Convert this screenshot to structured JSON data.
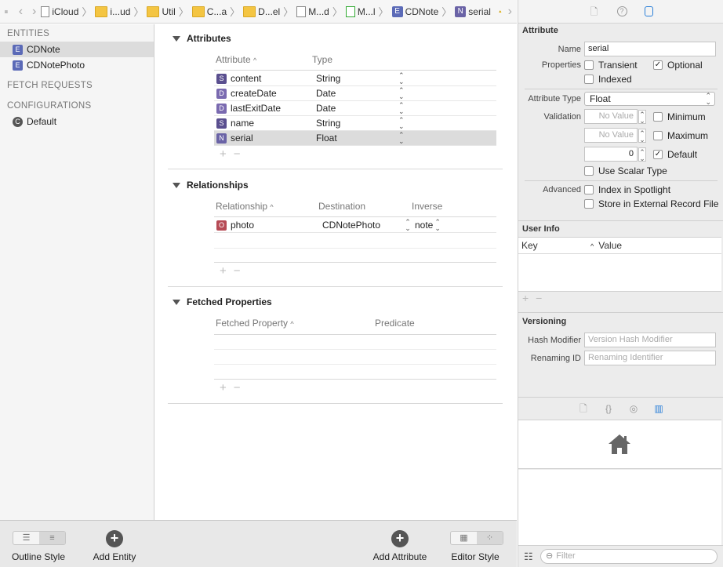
{
  "breadcrumb": {
    "items": [
      {
        "label": "iCloud",
        "icon": "folder-icon"
      },
      {
        "label": "i...ud",
        "icon": "folder-icon"
      },
      {
        "label": "Util",
        "icon": "folder-icon"
      },
      {
        "label": "C...a",
        "icon": "folder-icon"
      },
      {
        "label": "D...el",
        "icon": "folder-icon"
      },
      {
        "label": "M...d",
        "icon": "model-file-icon"
      },
      {
        "label": "M...l",
        "icon": "model-version-icon"
      },
      {
        "label": "CDNote",
        "icon": "entity-icon",
        "badge": "E"
      },
      {
        "label": "serial",
        "icon": "attribute-icon",
        "badge": "N"
      }
    ]
  },
  "sidebar": {
    "entities_header": "ENTITIES",
    "entities": [
      {
        "label": "CDNote",
        "badge": "E",
        "selected": true
      },
      {
        "label": "CDNotePhoto",
        "badge": "E",
        "selected": false
      }
    ],
    "fetch_header": "FETCH REQUESTS",
    "config_header": "CONFIGURATIONS",
    "configurations": [
      {
        "label": "Default",
        "badge": "C"
      }
    ]
  },
  "attributes": {
    "title": "Attributes",
    "col_attribute": "Attribute",
    "col_type": "Type",
    "rows": [
      {
        "badge": "S",
        "name": "content",
        "type": "String"
      },
      {
        "badge": "D",
        "name": "createDate",
        "type": "Date"
      },
      {
        "badge": "D",
        "name": "lastExitDate",
        "type": "Date"
      },
      {
        "badge": "S",
        "name": "name",
        "type": "String"
      },
      {
        "badge": "N",
        "name": "serial",
        "type": "Float",
        "selected": true
      }
    ]
  },
  "relationships": {
    "title": "Relationships",
    "col_relationship": "Relationship",
    "col_destination": "Destination",
    "col_inverse": "Inverse",
    "rows": [
      {
        "badge": "O",
        "name": "photo",
        "destination": "CDNotePhoto",
        "inverse": "note"
      }
    ]
  },
  "fetched": {
    "title": "Fetched Properties",
    "col_property": "Fetched Property",
    "col_predicate": "Predicate"
  },
  "bottom": {
    "outline_style": "Outline Style",
    "add_entity": "Add Entity",
    "add_attribute": "Add Attribute",
    "editor_style": "Editor Style"
  },
  "inspector": {
    "section_attribute": "Attribute",
    "name_label": "Name",
    "name_value": "serial",
    "properties_label": "Properties",
    "transient": "Transient",
    "optional": "Optional",
    "indexed": "Indexed",
    "type_label": "Attribute Type",
    "type_value": "Float",
    "validation_label": "Validation",
    "no_value": "No Value",
    "minimum": "Minimum",
    "maximum": "Maximum",
    "default_value": "0",
    "default_label": "Default",
    "scalar": "Use Scalar Type",
    "advanced_label": "Advanced",
    "spotlight": "Index in Spotlight",
    "external": "Store in External Record File",
    "user_info": "User Info",
    "key_col": "Key",
    "value_col": "Value",
    "versioning": "Versioning",
    "hash_label": "Hash Modifier",
    "hash_placeholder": "Version Hash Modifier",
    "renaming_label": "Renaming ID",
    "renaming_placeholder": "Renaming Identifier",
    "filter_placeholder": "Filter"
  }
}
